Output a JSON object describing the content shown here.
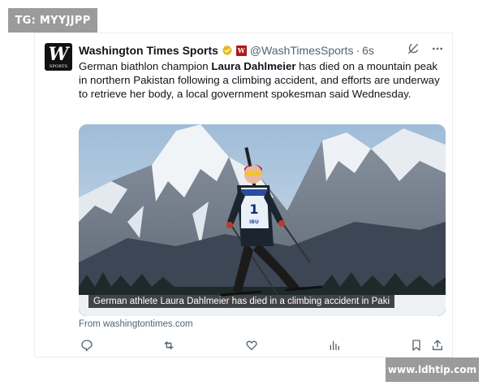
{
  "watermark_top": "TG: MYYJJPP",
  "watermark_bottom": "www.ldhtip.com",
  "tweet": {
    "account": {
      "logo_mark": "W",
      "logo_sub": "SPORTS",
      "name": "Washington Times Sports",
      "handle": "@WashTimesSports",
      "separator": "·",
      "time": "6s",
      "verified_color": "#e8b81e",
      "affiliate_color": "#b11a1a",
      "affiliate_mark": "W"
    },
    "text_before": "German biathlon champion ",
    "text_bold": "Laura Dahlmeier",
    "text_after": " has died on a mountain peak in northern Pakistan following a climbing accident, and efforts are underway to retrieve her body, a local government spokesman said Wednesday.",
    "media": {
      "caption": "German athlete Laura Dahlmeier has died in a climbing accident in Paki",
      "bib_number": "1",
      "bib_brand": "IBU"
    },
    "source": "From washingtontimes.com",
    "icons": {
      "grok": "grok-icon",
      "more": "more-icon",
      "reply": "reply-icon",
      "repost": "repost-icon",
      "like": "like-icon",
      "views": "views-icon",
      "bookmark": "bookmark-icon",
      "share": "share-icon"
    }
  }
}
